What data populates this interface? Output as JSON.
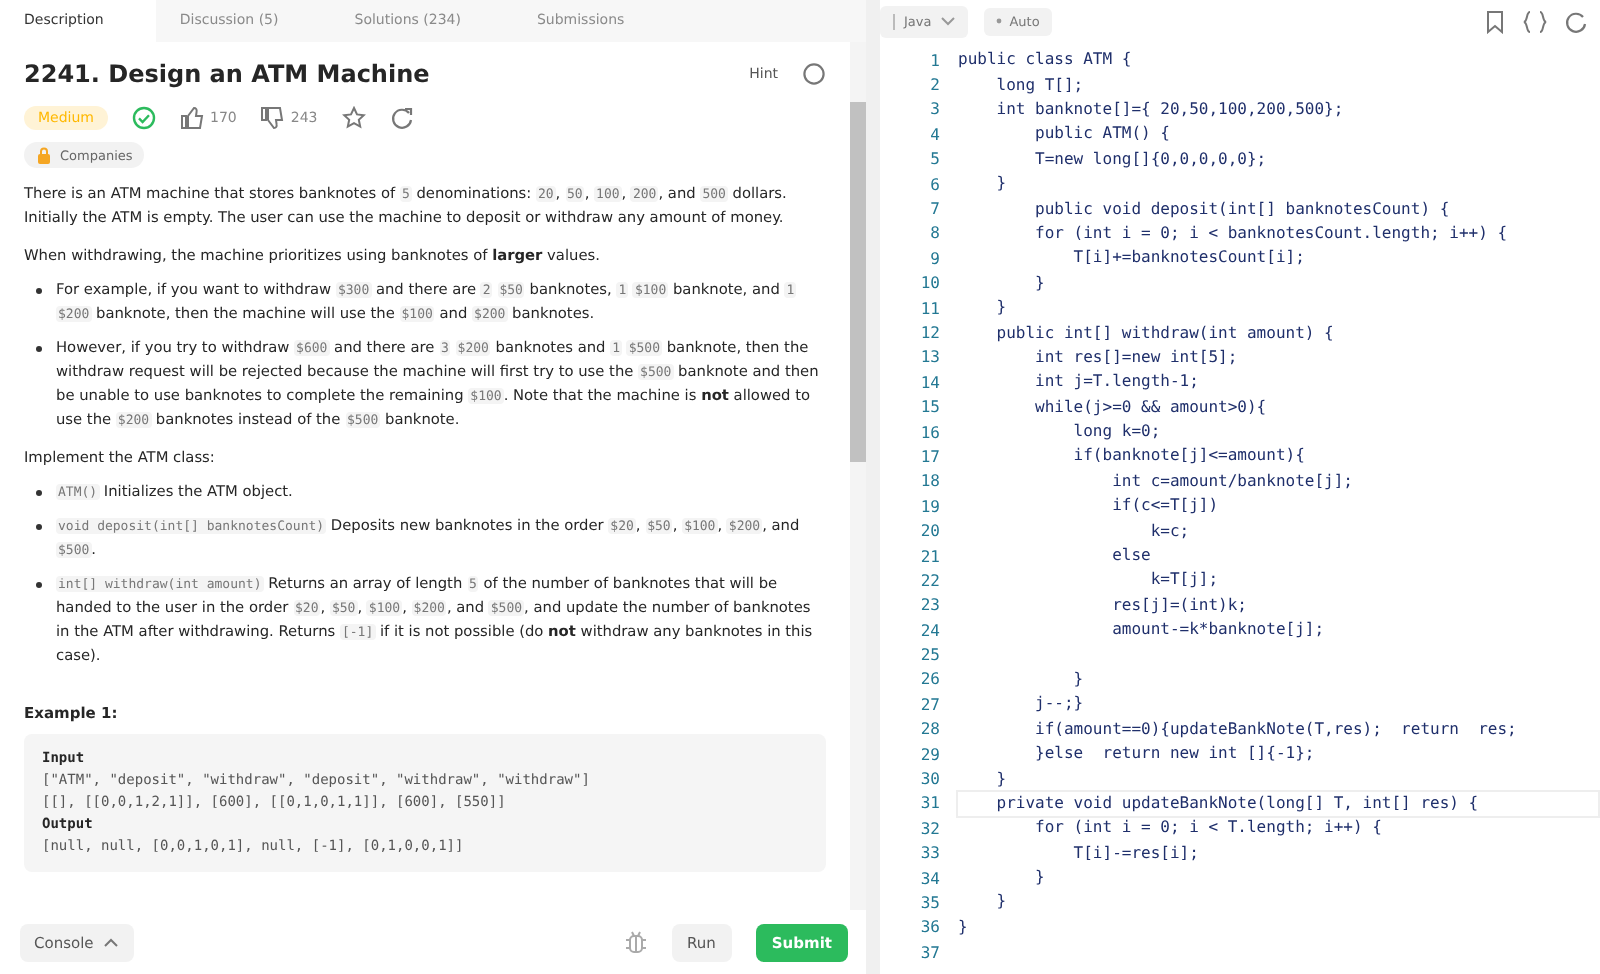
{
  "tabs": [
    {
      "label": "Description",
      "selected": true
    },
    {
      "label": "Discussion (5)",
      "selected": false
    },
    {
      "label": "Solutions (234)",
      "selected": false
    },
    {
      "label": "Submissions",
      "selected": false
    }
  ],
  "problem": {
    "title": "2241. Design an ATM Machine",
    "hint": "Hint",
    "difficulty": "Medium",
    "solved": true,
    "likes": "170",
    "dislikes": "243",
    "companies": "Companies"
  },
  "description": [
    {
      "kind": "para",
      "parts": [
        {
          "kind": "text",
          "text": "There is an ATM machine that stores banknotes of "
        },
        {
          "kind": "code",
          "text": "5"
        },
        {
          "kind": "text",
          "text": " denominations: "
        },
        {
          "kind": "code",
          "text": "20"
        },
        {
          "kind": "text",
          "text": ", "
        },
        {
          "kind": "code",
          "text": "50"
        },
        {
          "kind": "text",
          "text": ", "
        },
        {
          "kind": "code",
          "text": "100"
        },
        {
          "kind": "text",
          "text": ", "
        },
        {
          "kind": "code",
          "text": "200"
        },
        {
          "kind": "text",
          "text": ", and "
        },
        {
          "kind": "code",
          "text": "500"
        },
        {
          "kind": "text",
          "text": " dollars. Initially the ATM is empty. The user can use the machine to deposit or withdraw any amount of money."
        }
      ]
    },
    {
      "kind": "para",
      "parts": [
        {
          "kind": "text",
          "text": "When withdrawing, the machine prioritizes using banknotes of **larger** values."
        }
      ]
    },
    {
      "kind": "bullet",
      "parts": [
        {
          "kind": "text",
          "text": "For example, if you want to withdraw "
        },
        {
          "kind": "code",
          "text": "$300"
        },
        {
          "kind": "text",
          "text": " and there are "
        },
        {
          "kind": "code",
          "text": "2"
        },
        {
          "kind": "gap"
        },
        {
          "kind": "code",
          "text": "$50"
        },
        {
          "kind": "text",
          "text": " banknotes, "
        },
        {
          "kind": "code",
          "text": "1"
        },
        {
          "kind": "gap"
        },
        {
          "kind": "code",
          "text": "$100"
        },
        {
          "kind": "text",
          "text": " banknote, and "
        },
        {
          "kind": "code",
          "text": "1"
        },
        {
          "kind": "gap"
        },
        {
          "kind": "code",
          "text": "$200"
        },
        {
          "kind": "text",
          "text": " banknote, then the machine will use the "
        },
        {
          "kind": "code",
          "text": "$100"
        },
        {
          "kind": "text",
          "text": " and "
        },
        {
          "kind": "code",
          "text": "$200"
        },
        {
          "kind": "text",
          "text": " banknotes."
        }
      ]
    },
    {
      "kind": "bullet",
      "parts": [
        {
          "kind": "text",
          "text": "However, if you try to withdraw "
        },
        {
          "kind": "code",
          "text": "$600"
        },
        {
          "kind": "text",
          "text": " and there are "
        },
        {
          "kind": "code",
          "text": "3"
        },
        {
          "kind": "gap"
        },
        {
          "kind": "code",
          "text": "$200"
        },
        {
          "kind": "text",
          "text": " banknotes and "
        },
        {
          "kind": "code",
          "text": "1"
        },
        {
          "kind": "gap"
        },
        {
          "kind": "code",
          "text": "$500"
        },
        {
          "kind": "text",
          "text": " banknote, then the withdraw request will be rejected because the machine will first try to use the "
        },
        {
          "kind": "code",
          "text": "$500"
        },
        {
          "kind": "text",
          "text": " banknote and then be unable to use banknotes to complete the remaining "
        },
        {
          "kind": "code",
          "text": "$100"
        },
        {
          "kind": "text",
          "text": ". Note that the machine is **not** allowed to use the "
        },
        {
          "kind": "code",
          "text": "$200"
        },
        {
          "kind": "text",
          "text": " banknotes instead of the "
        },
        {
          "kind": "code",
          "text": "$500"
        },
        {
          "kind": "text",
          "text": " banknote."
        }
      ]
    },
    {
      "kind": "para",
      "parts": [
        {
          "kind": "text",
          "text": "Implement the ATM class:"
        }
      ]
    },
    {
      "kind": "bullet",
      "parts": [
        {
          "kind": "code",
          "text": "ATM()"
        },
        {
          "kind": "text",
          "text": " Initializes the ATM object."
        }
      ]
    },
    {
      "kind": "bullet",
      "parts": [
        {
          "kind": "code",
          "text": "void deposit(int[] banknotesCount)"
        },
        {
          "kind": "text",
          "text": " Deposits new banknotes in the order "
        },
        {
          "kind": "code",
          "text": "$20"
        },
        {
          "kind": "text",
          "text": ", "
        },
        {
          "kind": "code",
          "text": "$50"
        },
        {
          "kind": "text",
          "text": ", "
        },
        {
          "kind": "code",
          "text": "$100"
        },
        {
          "kind": "text",
          "text": ", "
        },
        {
          "kind": "code",
          "text": "$200"
        },
        {
          "kind": "text",
          "text": ", and "
        },
        {
          "kind": "code",
          "text": "$500"
        },
        {
          "kind": "text",
          "text": "."
        }
      ]
    },
    {
      "kind": "bullet",
      "parts": [
        {
          "kind": "code",
          "text": "int[] withdraw(int amount)"
        },
        {
          "kind": "text",
          "text": " Returns an array of length "
        },
        {
          "kind": "code",
          "text": "5"
        },
        {
          "kind": "text",
          "text": " of the number of banknotes that will be handed to the user in the order "
        },
        {
          "kind": "code",
          "text": "$20"
        },
        {
          "kind": "text",
          "text": ", "
        },
        {
          "kind": "code",
          "text": "$50"
        },
        {
          "kind": "text",
          "text": ", "
        },
        {
          "kind": "code",
          "text": "$100"
        },
        {
          "kind": "text",
          "text": ", "
        },
        {
          "kind": "code",
          "text": "$200"
        },
        {
          "kind": "text",
          "text": ", and "
        },
        {
          "kind": "code",
          "text": "$500"
        },
        {
          "kind": "text",
          "text": ", and update the number of banknotes in the ATM after withdrawing. Returns "
        },
        {
          "kind": "code",
          "text": "[-1]"
        },
        {
          "kind": "text",
          "text": " if it is not possible (do **not** withdraw any banknotes in this case)."
        }
      ]
    }
  ],
  "example": {
    "heading": "Example 1:",
    "lines": [
      {
        "kind": "label",
        "text": "Input"
      },
      {
        "kind": "code",
        "text": "[\"ATM\", \"deposit\", \"withdraw\", \"deposit\", \"withdraw\", \"withdraw\"]"
      },
      {
        "kind": "code",
        "text": "[[], [[0,0,1,2,1]], [600], [[0,1,0,1,1]], [600], [550]]"
      },
      {
        "kind": "label",
        "text": "Output"
      },
      {
        "kind": "code",
        "text": "[null, null, [0,0,1,0,1], null, [-1], [0,1,0,0,1]]"
      }
    ]
  },
  "bottom_bar": {
    "console": "Console",
    "run": "Run",
    "submit": "Submit"
  },
  "editor": {
    "language": "Java",
    "autocomplete": "Auto",
    "lines": [
      {
        "number": "1",
        "text": "public class ATM {",
        "current": false
      },
      {
        "number": "2",
        "text": "    long T[];",
        "current": false
      },
      {
        "number": "3",
        "text": "    int banknote[]={ 20,50,100,200,500};",
        "current": false
      },
      {
        "number": "4",
        "text": "        public ATM() {",
        "current": false
      },
      {
        "number": "5",
        "text": "        T=new long[]{0,0,0,0,0};",
        "current": false
      },
      {
        "number": "6",
        "text": "    }",
        "current": false
      },
      {
        "number": "7",
        "text": "        public void deposit(int[] banknotesCount) {",
        "current": false
      },
      {
        "number": "8",
        "text": "        for (int i = 0; i < banknotesCount.length; i++) {",
        "current": false
      },
      {
        "number": "9",
        "text": "            T[i]+=banknotesCount[i];",
        "current": false
      },
      {
        "number": "10",
        "text": "        }",
        "current": false
      },
      {
        "number": "11",
        "text": "    }",
        "current": false
      },
      {
        "number": "12",
        "text": "    public int[] withdraw(int amount) {",
        "current": false
      },
      {
        "number": "13",
        "text": "        int res[]=new int[5];",
        "current": false
      },
      {
        "number": "14",
        "text": "        int j=T.length-1;",
        "current": false
      },
      {
        "number": "15",
        "text": "        while(j>=0 && amount>0){",
        "current": false
      },
      {
        "number": "16",
        "text": "            long k=0;",
        "current": false
      },
      {
        "number": "17",
        "text": "            if(banknote[j]<=amount){",
        "current": false
      },
      {
        "number": "18",
        "text": "                int c=amount/banknote[j];",
        "current": false
      },
      {
        "number": "19",
        "text": "                if(c<=T[j])",
        "current": false
      },
      {
        "number": "20",
        "text": "                    k=c;",
        "current": false
      },
      {
        "number": "21",
        "text": "                else",
        "current": false
      },
      {
        "number": "22",
        "text": "                    k=T[j];",
        "current": false
      },
      {
        "number": "23",
        "text": "                res[j]=(int)k;",
        "current": false
      },
      {
        "number": "24",
        "text": "                amount-=k*banknote[j];",
        "current": false
      },
      {
        "number": "25",
        "current": false
      },
      {
        "number": "26",
        "text": "            }",
        "current": false
      },
      {
        "number": "27",
        "text": "        j--;}",
        "current": false
      },
      {
        "number": "28",
        "text": "        if(amount==0){updateBankNote(T,res);  return  res;",
        "current": false
      },
      {
        "number": "29",
        "text": "        }else  return new int []{-1};",
        "current": false
      },
      {
        "number": "30",
        "text": "    }",
        "current": false
      },
      {
        "number": "31",
        "text": "    private void updateBankNote(long[] T, int[] res) {",
        "current": true
      },
      {
        "number": "32",
        "text": "        for (int i = 0; i < T.length; i++) {",
        "current": false
      },
      {
        "number": "33",
        "text": "            T[i]-=res[i];",
        "current": false
      },
      {
        "number": "34",
        "text": "        }",
        "current": false
      },
      {
        "number": "35",
        "text": "    }",
        "current": false
      },
      {
        "number": "36",
        "text": "}",
        "current": false
      },
      {
        "number": "37",
        "current": false
      }
    ]
  }
}
